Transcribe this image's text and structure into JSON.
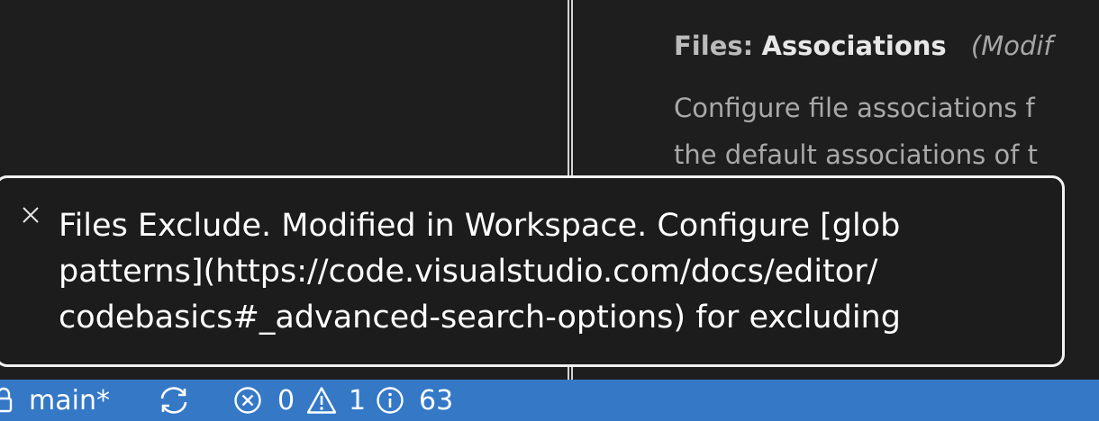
{
  "setting": {
    "category": "Files:",
    "name": "Associations",
    "modified_label": "(Modif",
    "description_lines": [
      "Configure file associations f",
      "the default associations of t"
    ]
  },
  "hover_message": {
    "lines": [
      "Files Exclude. Modified in Workspace. Configure [glob",
      "patterns](https://code.visualstudio.com/docs/editor/",
      "codebasics#_advanced-search-options) for excluding"
    ],
    "close_icon": "close-icon"
  },
  "status_bar": {
    "branch": "main*",
    "branch_icon": "lock-icon",
    "sync_icon": "sync-icon",
    "errors": "0",
    "warnings": "1",
    "info": "63",
    "color": "#3478c6"
  }
}
